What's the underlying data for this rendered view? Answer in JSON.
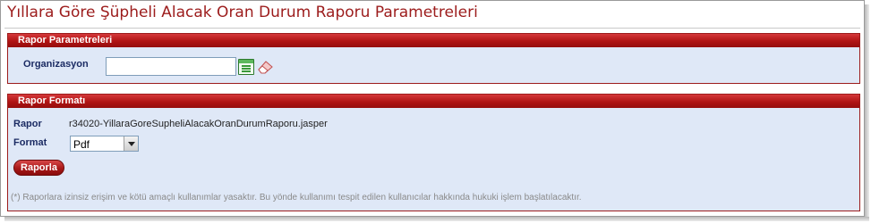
{
  "page": {
    "title": "Yıllara Göre Şüpheli Alacak Oran Durum Raporu Parametreleri"
  },
  "parameters_panel": {
    "header": "Rapor Parametreleri",
    "organizasyon_label": "Organizasyon",
    "organizasyon_value": "",
    "icons": [
      "list-select-icon",
      "eraser-icon"
    ]
  },
  "format_panel": {
    "header": "Rapor Formatı",
    "rapor_label": "Rapor",
    "rapor_file": "r34020-YillaraGoreSupheliAlacakOranDurumRaporu.jasper",
    "format_label": "Format",
    "format_selected": "Pdf",
    "submit_label": "Raporla",
    "disclaimer": "(*) Raporlara izinsiz erişim ve kötü amaçlı kullanımlar yasaktır. Bu yönde kullanımı tespit edilen kullanıcılar hakkında hukuki işlem başlatılacaktır."
  },
  "colors": {
    "accent": "#9c1c1c",
    "panel_bg": "#dfe8f7",
    "label_text": "#1b2b63"
  }
}
